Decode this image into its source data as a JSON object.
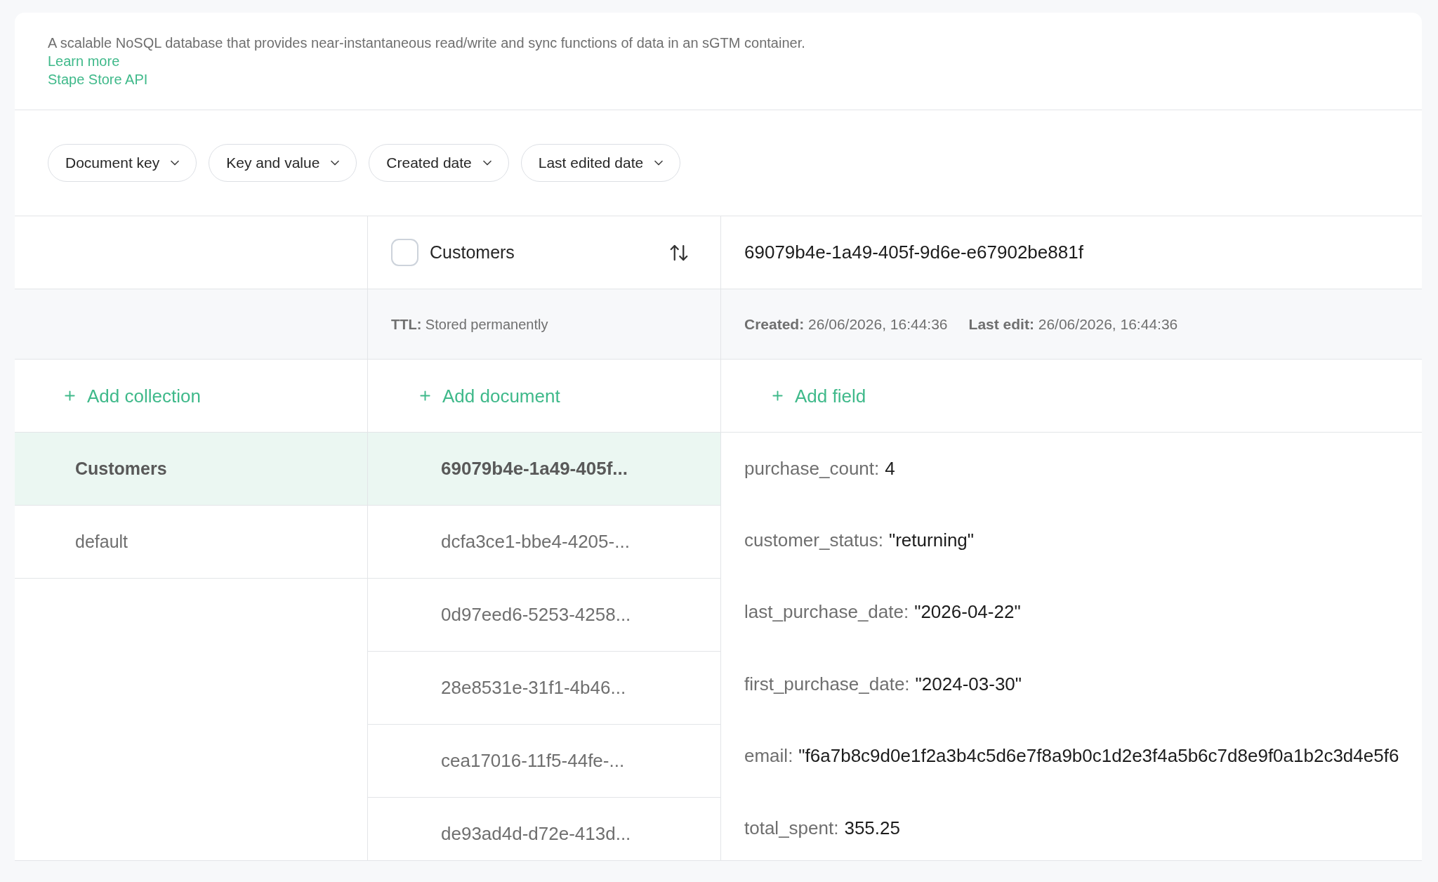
{
  "intro": {
    "description": "A scalable NoSQL database that provides near-instantaneous read/write and sync functions of data in an sGTM container.",
    "links": [
      "Learn more",
      "Stape Store API"
    ]
  },
  "filters": [
    {
      "label": "Document key"
    },
    {
      "label": "Key and value"
    },
    {
      "label": "Created date"
    },
    {
      "label": "Last edited date"
    }
  ],
  "collections_panel": {
    "add_label": "Add collection"
  },
  "documents_panel": {
    "checked": false,
    "title": "Customers",
    "ttl": "**TTL:** Stored permanently",
    "add_label": "Add document"
  },
  "document": {
    "id": "69079b4e-1a49-405f-9d6e-e67902be881f",
    "meta": [
      "**Created:** 26/06/2026, 16:44:36",
      "**Last edit:** 26/06/2026, 16:44:36"
    ],
    "add_label": "Add field"
  },
  "collections": [
    {
      "name": "Customers",
      "selected": true
    },
    {
      "name": "default",
      "selected": false
    }
  ],
  "documents": [
    {
      "id": "69079b4e-1a49-405f...",
      "selected": true
    },
    {
      "id": "dcfa3ce1-bbe4-4205-...",
      "selected": false
    },
    {
      "id": "0d97eed6-5253-4258...",
      "selected": false
    },
    {
      "id": "28e8531e-31f1-4b46...",
      "selected": false
    },
    {
      "id": "cea17016-11f5-44fe-...",
      "selected": false
    },
    {
      "id": "de93ad4d-d72e-413d...",
      "selected": false
    }
  ],
  "fields": [
    {
      "key": "purchase_count:",
      "value": "4"
    },
    {
      "key": "customer_status:",
      "value": "\"returning\""
    },
    {
      "key": "last_purchase_date:",
      "value": "\"2026-04-22\""
    },
    {
      "key": "first_purchase_date:",
      "value": "\"2024-03-30\""
    },
    {
      "key": "email:",
      "value": "\"f6a7b8c9d0e1f2a3b4c5d6e7f8a9b0c1d2e3f4a5b6c7d8e9f0a1b2c3d4e5f6"
    },
    {
      "key": "total_spent:",
      "value": "355.25"
    }
  ]
}
